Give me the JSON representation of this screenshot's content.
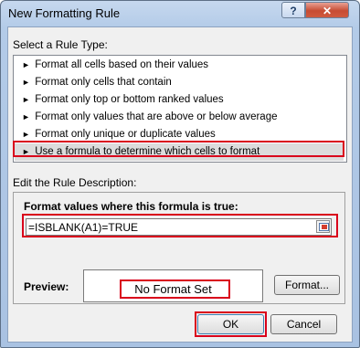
{
  "window": {
    "title": "New Formatting Rule",
    "help_glyph": "?",
    "close_glyph": "✕"
  },
  "rule_type": {
    "label": "Select a Rule Type:",
    "items": [
      "Format all cells based on their values",
      "Format only cells that contain",
      "Format only top or bottom ranked values",
      "Format only values that are above or below average",
      "Format only unique or duplicate values",
      "Use a formula to determine which cells to format"
    ],
    "selected_index": 5,
    "arrow": "►"
  },
  "description": {
    "label": "Edit the Rule Description:",
    "formula_prompt": "Format values where this formula is true:",
    "formula_value": "=ISBLANK(A1)=TRUE"
  },
  "preview": {
    "label": "Preview:",
    "text": "No Format Set"
  },
  "buttons": {
    "format": "Format...",
    "ok": "OK",
    "cancel": "Cancel"
  },
  "colors": {
    "highlight": "#d9001b",
    "title_bar": "#b9cfea"
  }
}
